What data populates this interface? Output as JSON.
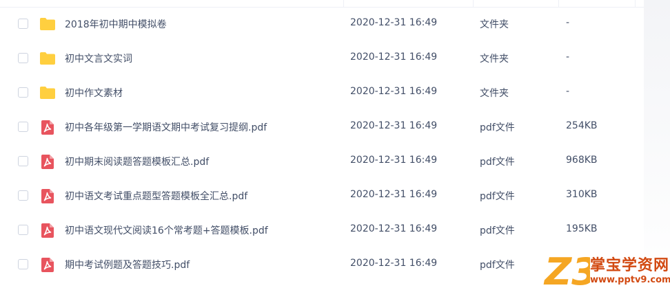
{
  "colors": {
    "folder": "#ffcf3f",
    "pdf": "#e8545e",
    "text": "#424e67",
    "watermark_orange": "#d24a12",
    "watermark_yellow": "#f5a623"
  },
  "files": [
    {
      "name": "2018年初中期中模拟卷",
      "date": "2020-12-31 16:49",
      "type": "文件夹",
      "size": "-",
      "icon": "folder-icon"
    },
    {
      "name": "初中文言文实词",
      "date": "2020-12-31 16:49",
      "type": "文件夹",
      "size": "-",
      "icon": "folder-icon"
    },
    {
      "name": "初中作文素材",
      "date": "2020-12-31 16:49",
      "type": "文件夹",
      "size": "-",
      "icon": "folder-icon"
    },
    {
      "name": "初中各年级第一学期语文期中考试复习提纲.pdf",
      "date": "2020-12-31 16:49",
      "type": "pdf文件",
      "size": "254KB",
      "icon": "pdf-icon"
    },
    {
      "name": "初中期末阅读题答题模板汇总.pdf",
      "date": "2020-12-31 16:49",
      "type": "pdf文件",
      "size": "968KB",
      "icon": "pdf-icon"
    },
    {
      "name": "初中语文考试重点题型答题模板全汇总.pdf",
      "date": "2020-12-31 16:49",
      "type": "pdf文件",
      "size": "310KB",
      "icon": "pdf-icon"
    },
    {
      "name": "初中语文现代文阅读16个常考题+答题模板.pdf",
      "date": "2020-12-31 16:49",
      "type": "pdf文件",
      "size": "195KB",
      "icon": "pdf-icon"
    },
    {
      "name": "期中考试例题及答题技巧.pdf",
      "date": "2020-12-31 16:49",
      "type": "pdf文件",
      "size": "",
      "icon": "pdf-icon"
    }
  ],
  "watermark": {
    "logo_text": "Z3",
    "title": "掌宝学资网",
    "url": "www.pptv9.com"
  }
}
